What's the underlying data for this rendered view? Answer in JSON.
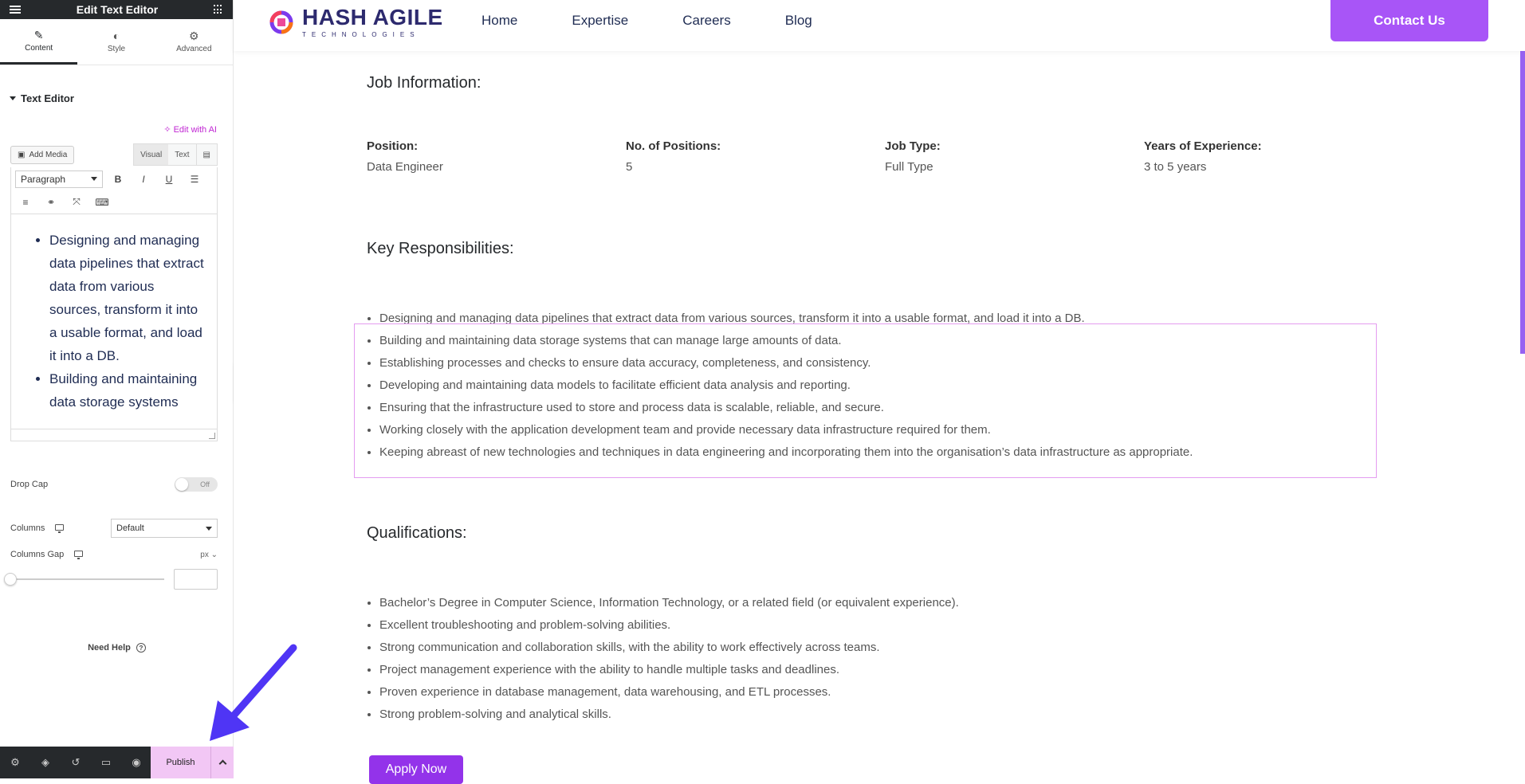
{
  "panel": {
    "title": "Edit Text Editor",
    "tabs": [
      {
        "label": "Content",
        "icon": "pencil-icon"
      },
      {
        "label": "Style",
        "icon": "half-circle-icon"
      },
      {
        "label": "Advanced",
        "icon": "gear-icon"
      }
    ],
    "section_title": "Text Editor",
    "edit_ai": "Edit with AI",
    "add_media": "Add Media",
    "mode_visual": "Visual",
    "mode_text": "Text",
    "paragraph_select": "Paragraph",
    "editor_content": [
      "Designing and managing data pipelines that extract data from various sources, transform it into a usable format, and load it into a DB.",
      "Building and maintaining data storage systems"
    ],
    "drop_cap_label": "Drop Cap",
    "drop_cap_state": "Off",
    "columns_label": "Columns",
    "columns_value": "Default",
    "columns_gap_label": "Columns Gap",
    "columns_gap_unit": "px",
    "need_help": "Need Help",
    "publish": "Publish"
  },
  "site": {
    "logo_main": "HASH AGILE",
    "logo_sub": "TECHNOLOGIES",
    "nav": [
      "Home",
      "Expertise",
      "Careers",
      "Blog"
    ],
    "contact": "Contact Us",
    "job_info_heading": "Job Information:",
    "job_info": [
      {
        "label": "Position:",
        "value": "Data Engineer"
      },
      {
        "label": "No. of Positions:",
        "value": "5"
      },
      {
        "label": "Job Type:",
        "value": "Full Type"
      },
      {
        "label": "Years of Experience:",
        "value": "3 to 5 years"
      }
    ],
    "responsibilities_heading": "Key Responsibilities:",
    "responsibilities": [
      "Designing and managing data pipelines that extract data from various sources, transform it into a usable format, and load it into a DB.",
      "Building and maintaining data storage systems that can manage large amounts of data.",
      "Establishing processes and checks to ensure data accuracy, completeness, and consistency.",
      "Developing and maintaining data models to facilitate efficient data analysis and reporting.",
      "Ensuring that the infrastructure used to store and process data is scalable, reliable, and secure.",
      "Working closely with the application development team and provide necessary data infrastructure required for them.",
      "Keeping abreast of new technologies and techniques in data engineering and incorporating them into the organisation’s data infrastructure as appropriate."
    ],
    "qualifications_heading": "Qualifications:",
    "qualifications": [
      "Bachelor’s Degree in Computer Science, Information Technology, or a related field (or equivalent experience).",
      "Excellent troubleshooting and problem-solving abilities.",
      "Strong communication and collaboration skills, with the ability to work effectively across teams.",
      "Project management experience with the ability to handle multiple tasks and deadlines.",
      "Proven experience in database management, data warehousing, and ETL processes.",
      "Strong problem-solving and analytical skills."
    ],
    "apply": "Apply Now"
  },
  "colors": {
    "accent": "#a855f7",
    "panel_dark": "#26292c",
    "publish_bg": "#f2c7f5",
    "arrow": "#4f35f5"
  }
}
